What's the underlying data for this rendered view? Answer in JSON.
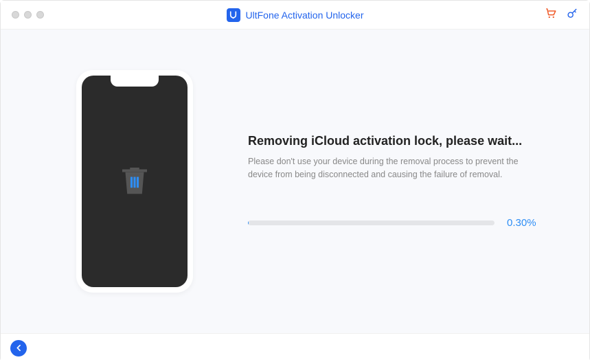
{
  "header": {
    "app_title": "UltFone Activation Unlocker"
  },
  "main": {
    "heading": "Removing iCloud activation lock, please wait...",
    "subtext": "Please don't use your device during the removal process to prevent the device from being disconnected and causing the failure of removal.",
    "progress_percent_label": "0.30%",
    "progress_value": 0.3
  }
}
